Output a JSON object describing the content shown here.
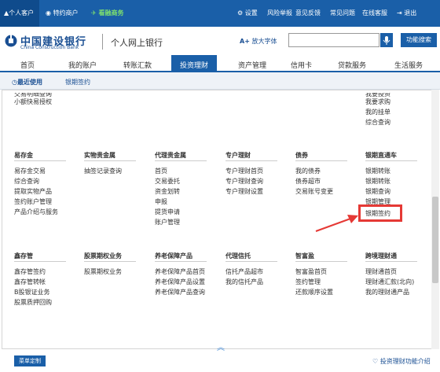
{
  "topbar": {
    "personal": "个人客户",
    "private": "特约商户",
    "wealth": "看融商务",
    "settings": "设置",
    "risk": "风险举报",
    "feedback": "意见反馈",
    "faq": "常见问题",
    "service": "在线客服",
    "logout": "退出"
  },
  "header": {
    "bank_cn": "中国建设银行",
    "bank_en": "China Construction Bank",
    "sub": "个人网上银行",
    "font_size": "放大字体",
    "search_placeholder": "",
    "func_search": "功能搜索"
  },
  "nav": {
    "items": [
      "首页",
      "我的账户",
      "转账汇款",
      "投资理财",
      "资产管理",
      "信用卡",
      "贷款服务",
      "生活服务"
    ],
    "active": "投资理财"
  },
  "subbar": {
    "recent": "最近使用",
    "recent_item": "银期签约"
  },
  "top_partial": {
    "left": [
      "交易明细查询",
      "小额快易授权"
    ],
    "right": [
      "我要投资",
      "我要求购",
      "我的挂单",
      "综合查询"
    ]
  },
  "sections": {
    "s1": {
      "col1": {
        "title": "易存金",
        "items": [
          "易存金交易",
          "综合查询",
          "提取实物产品",
          "签约账户管理",
          "产品介绍与服务"
        ]
      },
      "col2": {
        "title": "实物贵金属",
        "items": [
          "抽签记录查询"
        ]
      },
      "col3": {
        "title": "代理贵金属",
        "items": [
          "首页",
          "交易委托",
          "资金划转",
          "申报",
          "提货申请",
          "账户管理"
        ]
      },
      "col4": {
        "title": "专户理财",
        "items": [
          "专户理财首页",
          "专户理财查询",
          "专户理财设置"
        ]
      },
      "col5": {
        "title": "债券",
        "items": [
          "我的债券",
          "债券超市",
          "交易账号变更"
        ]
      },
      "col6": {
        "title": "银期直通车",
        "items": [
          "银期转账",
          "银期转账",
          "银期查询",
          "银期管理",
          "银期签约"
        ]
      }
    },
    "s2": {
      "col1": {
        "title": "鑫存管",
        "items": [
          "鑫存管签约",
          "鑫存管转帐",
          "B股银证业务",
          "股票质押回购"
        ]
      },
      "col2": {
        "title": "股票期权业务",
        "items": [
          "股票期权业务"
        ]
      },
      "col3": {
        "title": "养老保障产品",
        "items": [
          "养老保障产品首页",
          "养老保障产品设置",
          "养老保障产品查询"
        ]
      },
      "col4": {
        "title": "代理信托",
        "items": [
          "信托产品超市",
          "我的信托产品"
        ]
      },
      "col5": {
        "title": "智富盈",
        "items": [
          "智富盈首页",
          "签约管理",
          "还款顺序设置"
        ]
      },
      "col6": {
        "title": "跨境理财通",
        "items": [
          "理财通首页",
          "理财通汇款(北向)",
          "我的理财通产品"
        ]
      }
    }
  },
  "footer": {
    "menu_custom": "菜单定制",
    "intro": "投资理财功能介绍"
  },
  "colors": {
    "primary": "#1a5fa8",
    "highlight": "#e53935"
  }
}
